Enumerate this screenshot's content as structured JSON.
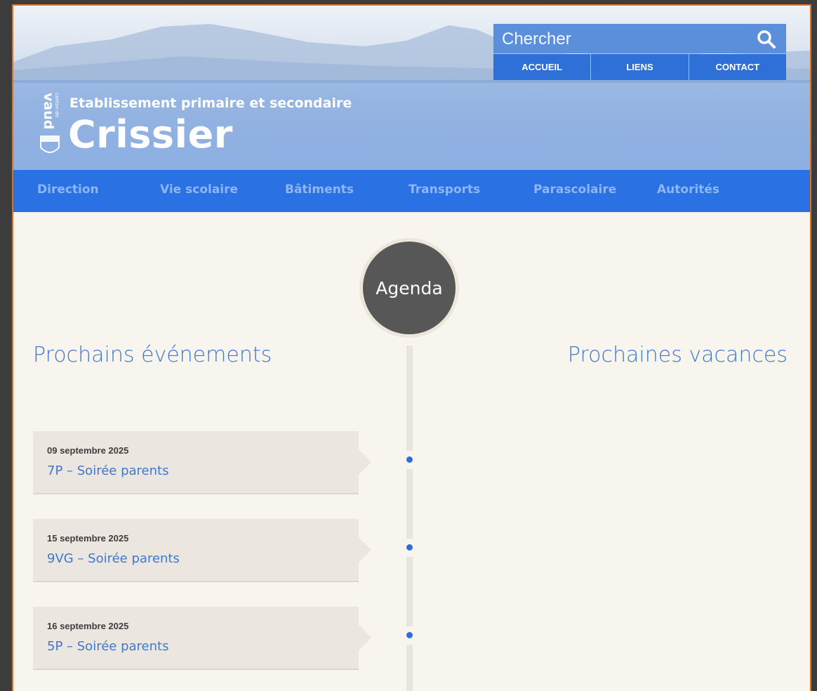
{
  "search": {
    "placeholder": "Chercher"
  },
  "top_links": [
    "ACCUEIL",
    "LIENS",
    "CONTACT"
  ],
  "header": {
    "subtitle": "Etablissement primaire et secondaire",
    "title": "Crissier",
    "crest_text": "canton de vaud"
  },
  "nav": [
    "Direction",
    "Vie scolaire",
    "Bâtiments",
    "Transports",
    "Parascolaire",
    "Autorités"
  ],
  "agenda": {
    "label": "Agenda",
    "left_heading": "Prochains événements",
    "right_heading": "Prochaines vacances",
    "events": [
      {
        "date": "09 septembre 2025",
        "title": "7P – Soirée parents"
      },
      {
        "date": "15 septembre 2025",
        "title": "9VG – Soirée parents"
      },
      {
        "date": "16 septembre 2025",
        "title": "5P – Soirée parents"
      }
    ]
  },
  "colors": {
    "nav_bg": "#2a72e4",
    "nav_text": "#8fb6f2",
    "link_blue": "#3f78cf",
    "page_bg": "#f8f5ef",
    "frame_border": "#d9731f"
  },
  "icons": {
    "search": "search-icon",
    "crest": "vaud-crest-logo"
  }
}
